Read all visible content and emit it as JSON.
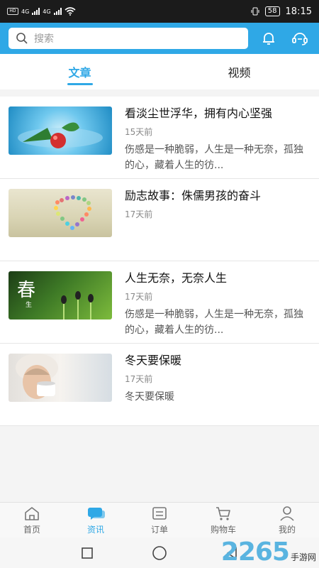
{
  "status_bar": {
    "time": "18:15",
    "battery": "58",
    "network_left": "HD",
    "network_types": [
      "4G",
      "4G"
    ]
  },
  "header": {
    "search_placeholder": "搜索"
  },
  "tabs": [
    {
      "label": "文章",
      "active": true
    },
    {
      "label": "视频",
      "active": false
    }
  ],
  "articles": [
    {
      "title": "看淡尘世浮华，拥有内心坚强",
      "date": "15天前",
      "summary": "伤感是一种脆弱，人生是一种无奈，孤独的心，藏着人生的彷..."
    },
    {
      "title": "励志故事：侏儒男孩的奋斗",
      "date": "17天前",
      "summary": ""
    },
    {
      "title": "人生无奈，无奈人生",
      "date": "17天前",
      "summary": "伤感是一种脆弱，人生是一种无奈，孤独的心，藏着人生的彷..."
    },
    {
      "title": "冬天要保暖",
      "date": "17天前",
      "summary": "冬天要保暖"
    }
  ],
  "thumbs": {
    "spring_char": "春",
    "spring_sub": "生"
  },
  "bottom_nav": [
    {
      "label": "首页",
      "icon": "home-icon",
      "active": false
    },
    {
      "label": "资讯",
      "icon": "chat-icon",
      "active": true
    },
    {
      "label": "订单",
      "icon": "order-icon",
      "active": false
    },
    {
      "label": "购物车",
      "icon": "cart-icon",
      "active": false
    },
    {
      "label": "我的",
      "icon": "user-icon",
      "active": false
    }
  ],
  "watermark": {
    "number": "2265",
    "text": "手游网"
  },
  "colors": {
    "accent": "#2fa8e6",
    "status_bar": "#1b1b1b"
  }
}
